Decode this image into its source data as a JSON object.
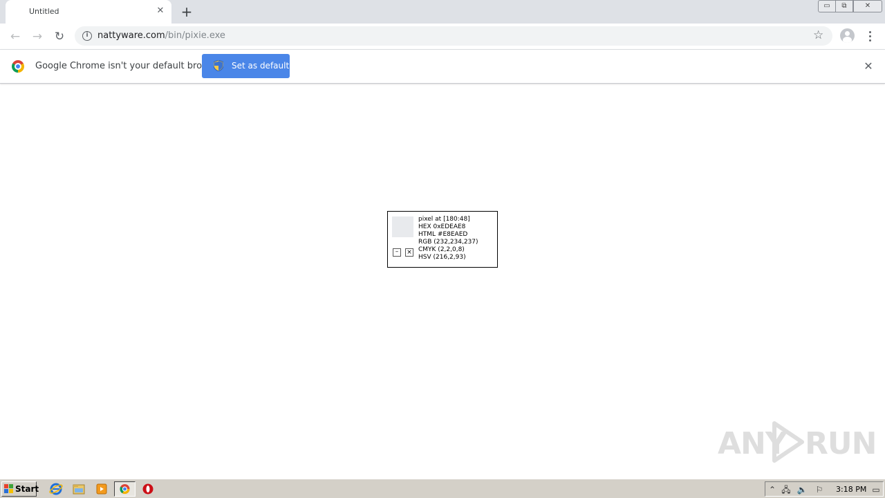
{
  "browser": {
    "tab": {
      "title": "Untitled",
      "close_glyph": "✕"
    },
    "new_tab_glyph": "+",
    "window_controls": {
      "minimize": "▭",
      "maximize": "⧉",
      "close": "✕"
    },
    "nav": {
      "back": "←",
      "forward": "→",
      "reload": "↻"
    },
    "omnibox": {
      "url_host": "nattyware.com",
      "url_path": "/bin/pixie.exe"
    },
    "star_glyph": "☆"
  },
  "infobar": {
    "message": "Google Chrome isn't your default browser",
    "button_label": "Set as default",
    "close_glyph": "✕"
  },
  "pixie": {
    "swatch_color": "#e8eaed",
    "minimize_label": "–",
    "close_label": "×",
    "lines": [
      "pixel at [180:48]",
      "HEX 0xEDEAE8",
      "HTML #E8EAED",
      "RGB (232,234,237)",
      "CMYK (2,2,0,8)",
      "HSV (216,2,93)"
    ]
  },
  "watermark": {
    "left": "ANY",
    "right": "RUN"
  },
  "taskbar": {
    "start_label": "Start",
    "apps": [
      "ie-icon",
      "explorer-icon",
      "media-player-icon",
      "chrome-icon",
      "opera-icon"
    ],
    "clock": "3:18 PM"
  },
  "colors": {
    "accent": "#4a86e8",
    "taskbar": "#d4d0c8"
  }
}
